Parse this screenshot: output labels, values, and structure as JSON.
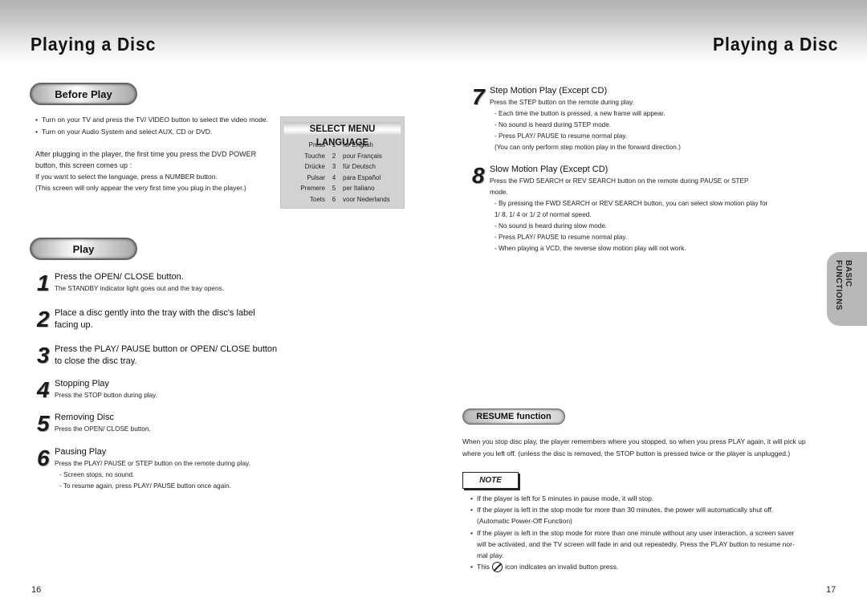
{
  "header": {
    "title_left": "Playing a Disc",
    "title_right": "Playing a Disc"
  },
  "left_page": {
    "before_play": {
      "heading": "Before Play",
      "bullets": [
        "Turn on your TV and press the TV/ VIDEO button to select the video mode.",
        "Turn on your Audio System and select AUX, CD or DVD."
      ],
      "intro_lines": [
        "After plugging in the player, the first time you press the DVD POWER",
        "button, this screen comes up :",
        "If you want to select the language, press a NUMBER button.",
        "(This screen will only appear the very first time you plug in the player.)"
      ]
    },
    "language_menu": {
      "title": "SELECT MENU LANGUAGE",
      "rows": [
        {
          "verb": "Press",
          "num": "1",
          "lang": "for English"
        },
        {
          "verb": "Touche",
          "num": "2",
          "lang": "pour Français"
        },
        {
          "verb": "Drücke",
          "num": "3",
          "lang": "für Deutsch"
        },
        {
          "verb": "Pulsar",
          "num": "4",
          "lang": "para Español"
        },
        {
          "verb": "Premere",
          "num": "5",
          "lang": "per Italiano"
        },
        {
          "verb": "Toets",
          "num": "6",
          "lang": "voor  Nederlands"
        }
      ]
    },
    "play": {
      "heading": "Play",
      "steps": [
        {
          "num": "1",
          "head": "Press the OPEN/ CLOSE button.",
          "body": [
            "The STANDBY indicator light goes out and the tray opens."
          ]
        },
        {
          "num": "2",
          "head": "Place a disc gently into the tray with the disc's label",
          "head2": "facing up.",
          "body": []
        },
        {
          "num": "3",
          "head": "Press the PLAY/ PAUSE button or OPEN/ CLOSE button",
          "head2": "to close the disc tray.",
          "body": []
        },
        {
          "num": "4",
          "head": "Stopping Play",
          "body": [
            "Press the STOP button during play."
          ]
        },
        {
          "num": "5",
          "head": "Removing Disc",
          "body": [
            "Press the OPEN/ CLOSE button."
          ]
        },
        {
          "num": "6",
          "head": "Pausing Play",
          "body": [
            "Press the PLAY/ PAUSE or STEP button on the remote during play.",
            "- Screen stops, no sound.",
            "- To resume again, press PLAY/ PAUSE button once again."
          ]
        }
      ]
    },
    "page_number": "16"
  },
  "right_page": {
    "steps": [
      {
        "num": "7",
        "head": "Step Motion Play (Except CD)",
        "body": [
          "Press the STEP button on the remote during play.",
          "- Each time the button is pressed, a new frame will appear.",
          "- No sound is heard during STEP mode.",
          "- Press PLAY/ PAUSE to resume normal play.",
          "  (You can only perform step motion play in the forward direction.)"
        ]
      },
      {
        "num": "8",
        "head": "Slow Motion Play (Except CD)",
        "body": [
          "Press the FWD SEARCH or REV SEARCH button on the remote during PAUSE or STEP",
          "mode.",
          "- By pressing the FWD SEARCH or REV SEARCH button, you can select slow motion play for",
          "  1/ 8, 1/ 4 or 1/ 2 of normal speed.",
          "- No sound is heard during slow mode.",
          "- Press PLAY/ PAUSE to resume normal play.",
          "- When playing a VCD, the reverse slow motion play will not work."
        ]
      }
    ],
    "side_tab": {
      "line1": "BASIC",
      "line2": "FUNCTIONS"
    },
    "resume": {
      "heading": "RESUME function",
      "lines": [
        "When you stop disc play, the player remembers where you stopped, so when you press PLAY again, it will pick up",
        "where you left off. (unless the disc is removed, the STOP button is pressed twice or the player is unplugged.)"
      ]
    },
    "note": {
      "label": "NOTE",
      "items": [
        [
          "If the player is left for 5 minutes in pause mode, it will stop."
        ],
        [
          "If the player is left in the stop mode for more than 30 minutes, the power will automatically shut off.",
          "(Automatic Power-Off Function)"
        ],
        [
          "If the player is left in the stop mode for more than one minute without any user interaction, a screen saver",
          "will be activated, and the TV screen will fade in and out repeatedly. Press the PLAY button to resume nor-",
          "mal play."
        ]
      ],
      "icon_item_before": "This",
      "icon_item_after": "icon indicates an invalid button press.",
      "icon": "invalid-circle-slash-icon"
    },
    "page_number": "17"
  }
}
